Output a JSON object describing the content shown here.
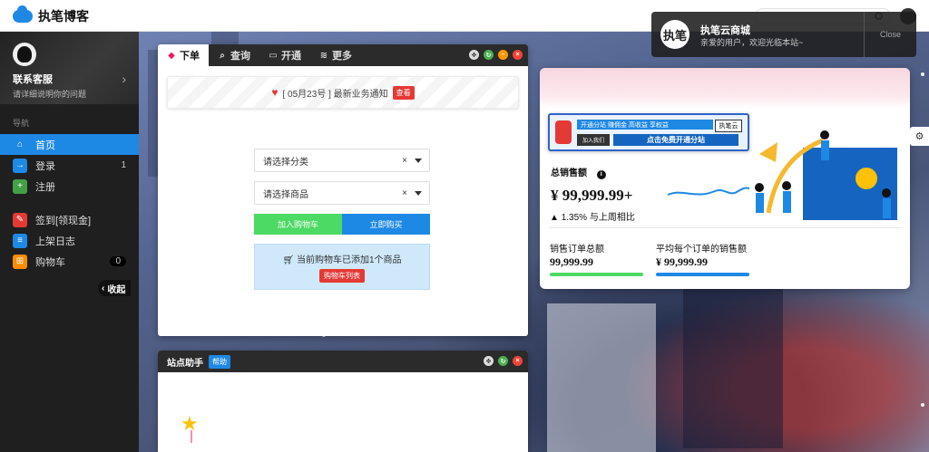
{
  "brand": {
    "name": "执笔博客"
  },
  "toast": {
    "logo_text": "执笔",
    "title": "执笔云商城",
    "message": "亲爱的用户，欢迎光临本站~",
    "close_label": "Close"
  },
  "sidebar": {
    "user_name": "联系客服",
    "user_sub": "请详细说明你的问题",
    "section_label": "导航",
    "items": [
      {
        "label": "首页",
        "count": ""
      },
      {
        "label": "登录",
        "count": "1"
      },
      {
        "label": "注册",
        "count": ""
      },
      {
        "label": "签到[领现金]",
        "count": ""
      },
      {
        "label": "上架日志",
        "count": ""
      },
      {
        "label": "购物车",
        "count": "0"
      }
    ],
    "collapse_label": "收起"
  },
  "order_window": {
    "tabs": [
      "下单",
      "查询",
      "开通",
      "更多"
    ],
    "notice_text": "[ 05月23号 ] 最新业务通知",
    "notice_button": "查看",
    "category_placeholder": "请选择分类",
    "product_placeholder": "请选择商品",
    "clear_symbol": "×",
    "add_cart_label": "加入购物车",
    "buy_now_label": "立即购买",
    "cart_status": "当前购物车已添加1个商品",
    "cart_list_button": "购物车列表"
  },
  "assistant_window": {
    "title": "站点助手",
    "help_label": "帮助"
  },
  "dashboard": {
    "banner": {
      "top_text": "开通分站 赚佣金 高收益 享权益",
      "join_label": "加入我们",
      "main_text": "点击免费开通分站",
      "tag_text": "执笔云"
    },
    "total_sales_label": "总销售额",
    "total_sales_value": "¥ 99,999.99+",
    "delta_text": "1.35% 与上周相比",
    "orders_label": "销售订单总额",
    "orders_value": "99,999.99",
    "avg_label": "平均每个订单的销售额",
    "avg_value": "¥ 99,999.99"
  },
  "colors": {
    "accent": "#1e88e5",
    "danger": "#e53935",
    "success": "#4cd964"
  },
  "icons": {
    "home": "home-icon",
    "login": "login-icon",
    "register": "register-icon",
    "checkin": "checkin-icon",
    "log": "log-icon",
    "cart": "cart-icon"
  }
}
